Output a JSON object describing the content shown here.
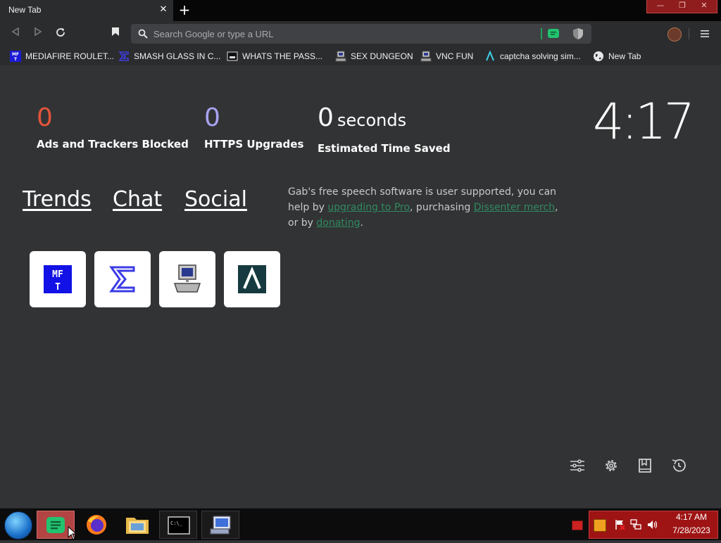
{
  "browser": {
    "tab_title": "New Tab",
    "tab_close": "✕",
    "new_tab": "+",
    "url_placeholder": "Search Google or type a URL",
    "window_controls": {
      "minimize": "—",
      "maximize": "❐",
      "close": "✕"
    }
  },
  "bookmarks": [
    {
      "label": "MEDIAFIRE ROULET...",
      "icon": "mediafire-icon"
    },
    {
      "label": "SMASH GLASS IN C...",
      "icon": "sigma-icon"
    },
    {
      "label": "WHATS THE PASS...",
      "icon": "terminal-icon"
    },
    {
      "label": "SEX DUNGEON",
      "icon": "computer-icon"
    },
    {
      "label": "VNC FUN",
      "icon": "computer-icon"
    },
    {
      "label": "captcha solving sim...",
      "icon": "lambda-icon"
    },
    {
      "label": "New Tab",
      "icon": "globe-icon"
    }
  ],
  "stats": {
    "ads": {
      "value": "0",
      "label": "Ads and Trackers Blocked",
      "color": "#e2553b"
    },
    "https": {
      "value": "0",
      "label": "HTTPS Upgrades",
      "color": "#a8a4f0"
    },
    "time": {
      "value": "0",
      "unit": "seconds",
      "label": "Estimated Time Saved",
      "color": "#ffffff"
    }
  },
  "clock": "4:17",
  "links": {
    "trends": "Trends",
    "chat": "Chat",
    "social": "Social"
  },
  "gab_message": {
    "part1": "Gab's free speech software is user supported, you can help by ",
    "link1": "upgrading to Pro",
    "part2": ", purchasing ",
    "link2": "Dissenter merch",
    "part3": ", or by ",
    "link3": "donating",
    "part4": "."
  },
  "tiles": [
    {
      "icon": "mediafire-icon",
      "text": "MF T"
    },
    {
      "icon": "sigma-icon"
    },
    {
      "icon": "computer-icon"
    },
    {
      "icon": "lambda-icon"
    }
  ],
  "tray": {
    "time": "4:17 AM",
    "date": "7/28/2023"
  },
  "colors": {
    "accent_green": "#2f8b5e",
    "page_bg": "#323335",
    "tray_red": "#9e1414"
  }
}
